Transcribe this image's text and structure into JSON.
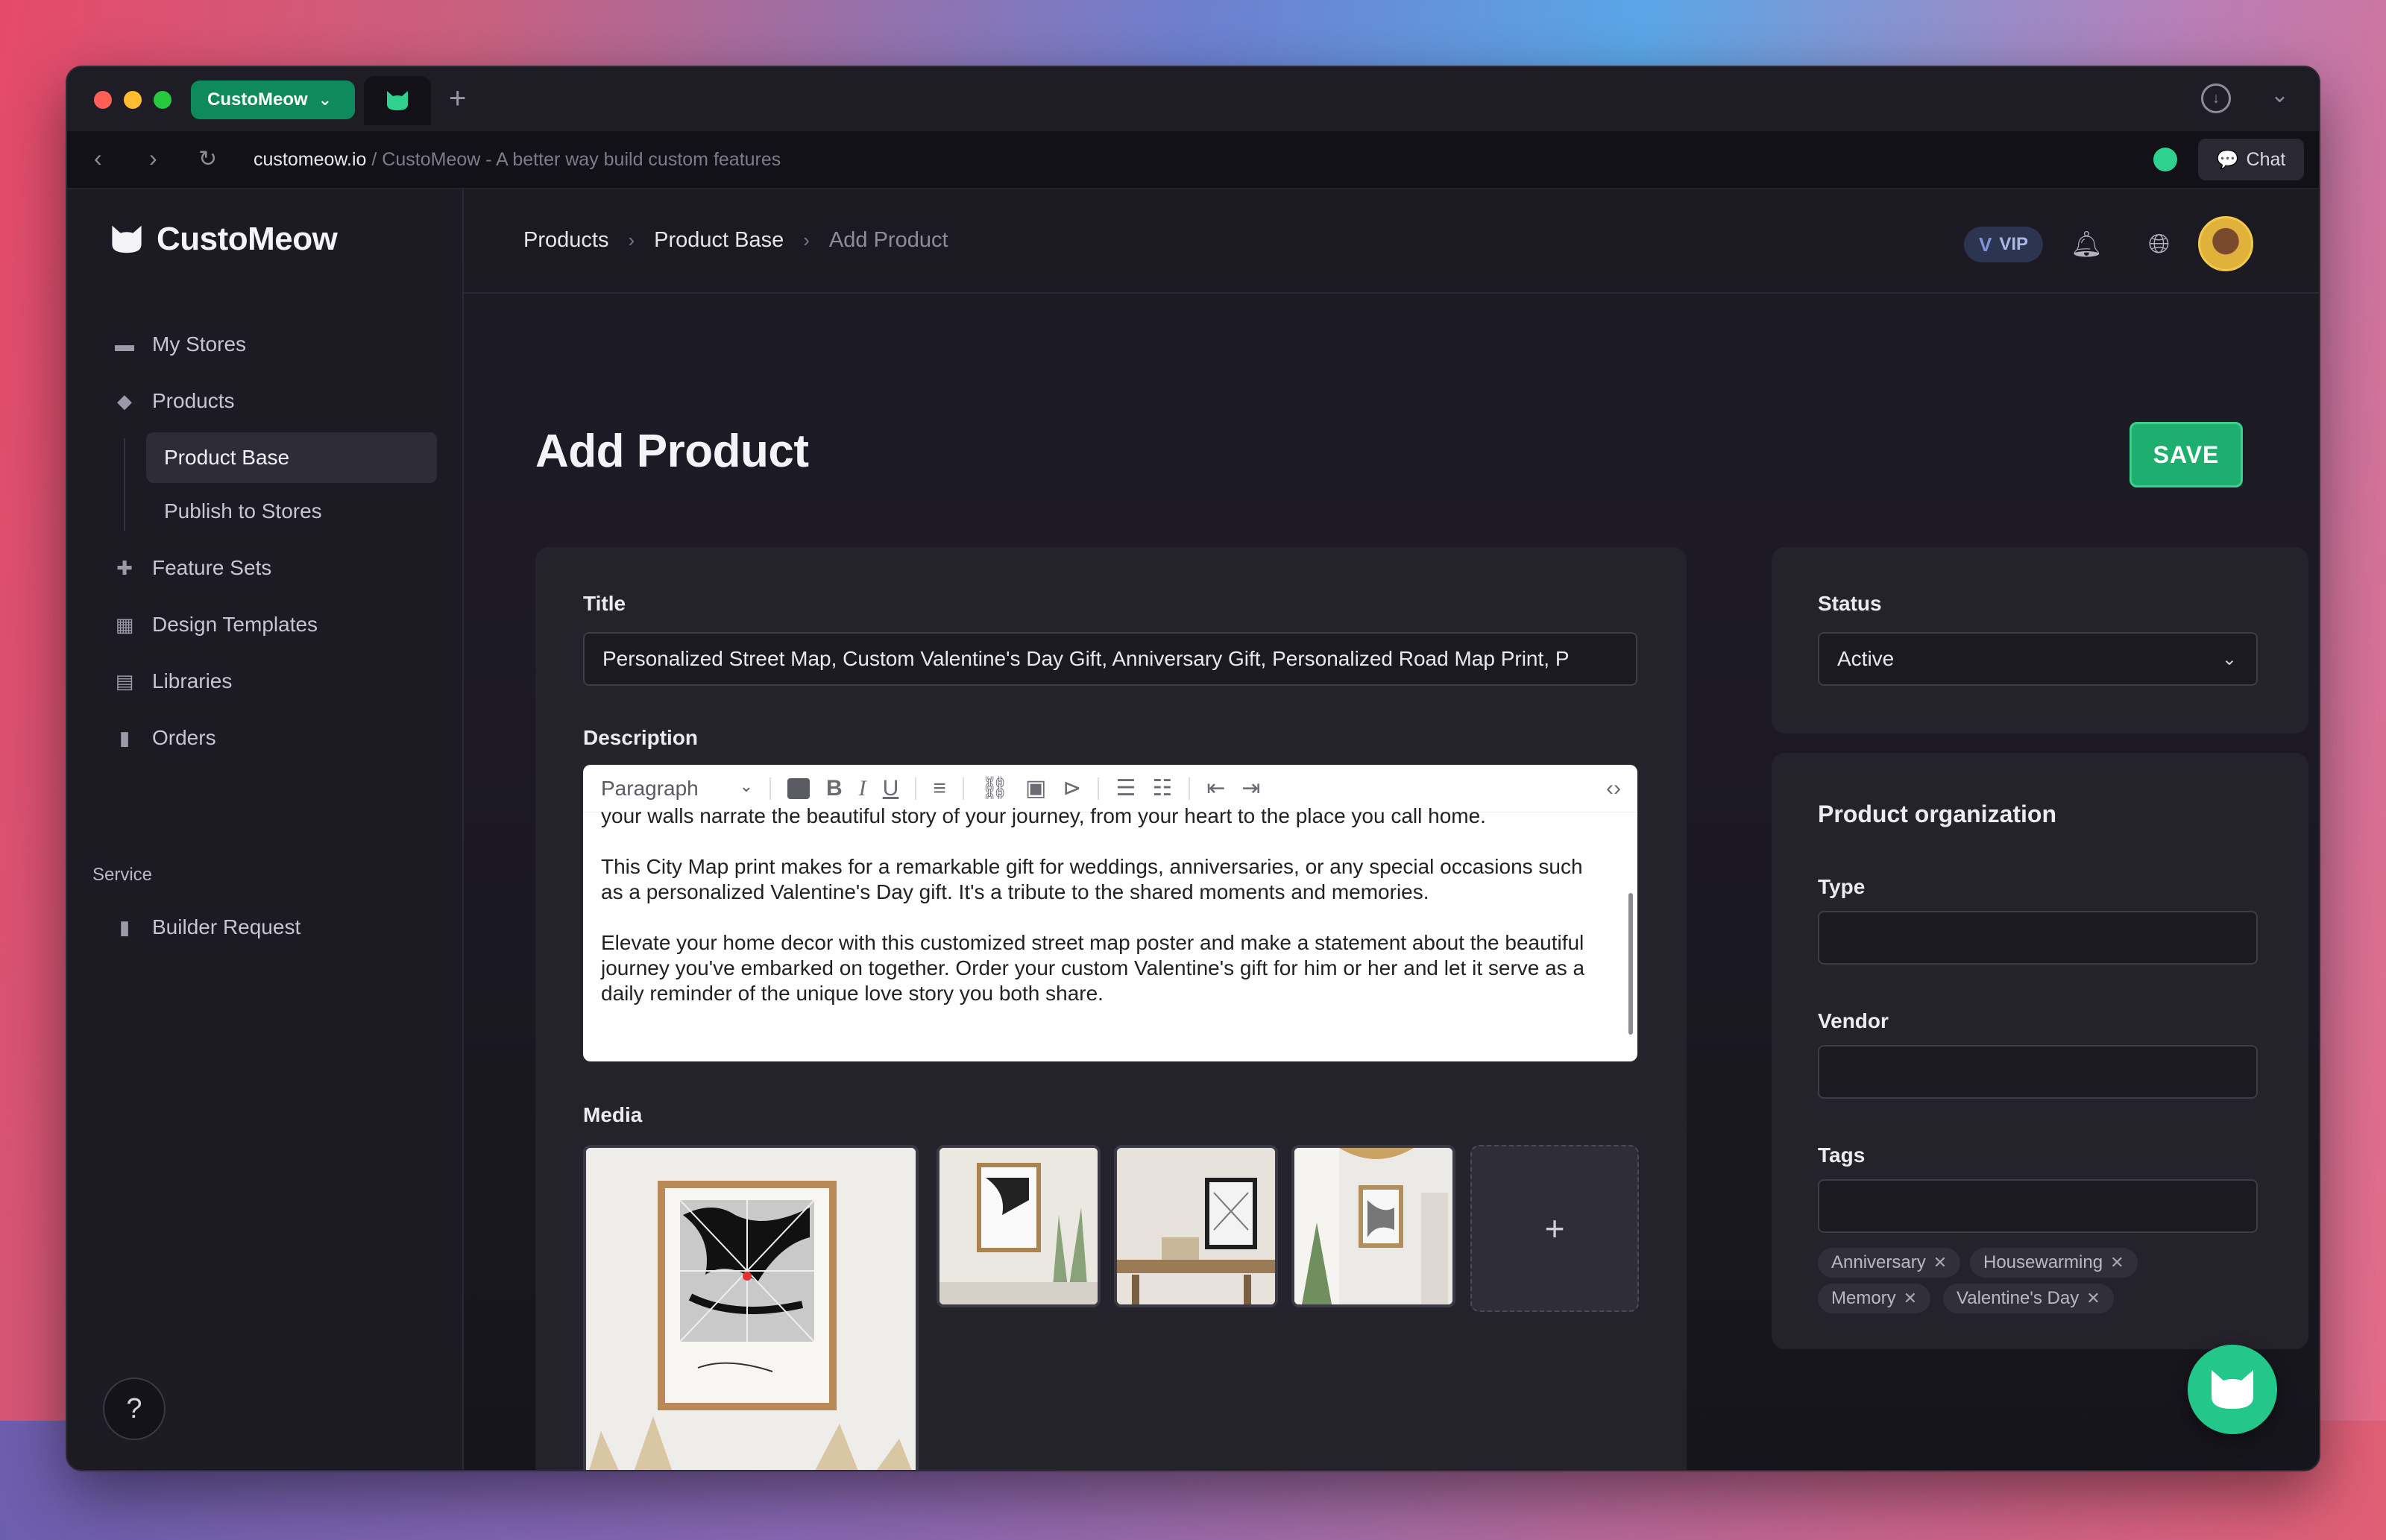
{
  "browser": {
    "tab_pill_label": "CustoMeow",
    "url_domain": "customeow.io",
    "url_rest": " / CustoMeow - A better way build custom features",
    "chat_label": "Chat"
  },
  "sidebar": {
    "brand": "CustoMeow",
    "items": [
      {
        "label": "My Stores",
        "icon": "store-icon"
      },
      {
        "label": "Products",
        "icon": "tag-icon"
      }
    ],
    "sub_items": [
      {
        "label": "Product Base",
        "active": true
      },
      {
        "label": "Publish to Stores",
        "active": false
      }
    ],
    "items2": [
      {
        "label": "Feature Sets",
        "icon": "puzzle-icon"
      },
      {
        "label": "Design Templates",
        "icon": "template-icon"
      },
      {
        "label": "Libraries",
        "icon": "library-icon"
      },
      {
        "label": "Orders",
        "icon": "document-icon"
      }
    ],
    "section_label": "Service",
    "service_items": [
      {
        "label": "Builder Request",
        "icon": "request-icon"
      }
    ],
    "help_label": "?"
  },
  "header": {
    "breadcrumbs": [
      "Products",
      "Product Base",
      "Add Product"
    ],
    "vip_label": "VIP"
  },
  "page": {
    "title": "Add Product",
    "save_label": "SAVE"
  },
  "form": {
    "title_label": "Title",
    "title_value": "Personalized Street Map, Custom Valentine's Day Gift, Anniversary Gift, Personalized Road Map Print, P",
    "description_label": "Description",
    "editor_toolbar": {
      "paragraph": "Paragraph"
    },
    "description_paragraphs": [
      "your walls narrate the beautiful story of your journey, from your heart to the place you call home.",
      "This City Map print makes for a remarkable gift for weddings, anniversaries, or any special occasions such as a personalized Valentine's Day gift. It's a tribute to the shared moments and memories.",
      "Elevate your home decor with this customized street map poster and make a statement about the beautiful journey you've embarked on together. Order your custom Valentine's gift for him or her and let it serve as a daily reminder of the unique love story you both share."
    ],
    "media_label": "Media",
    "add_media_label": "+"
  },
  "status": {
    "label": "Status",
    "value": "Active"
  },
  "organization": {
    "heading": "Product organization",
    "type_label": "Type",
    "type_value": "",
    "vendor_label": "Vendor",
    "vendor_value": "",
    "tags_label": "Tags",
    "tags_input": "",
    "tags": [
      "Anniversary",
      "Housewarming",
      "Memory",
      "Valentine's Day"
    ]
  },
  "colors": {
    "accent": "#1eae6f",
    "brand_green": "#23c78a",
    "background": "#1b1a22",
    "card": "#24232c"
  }
}
